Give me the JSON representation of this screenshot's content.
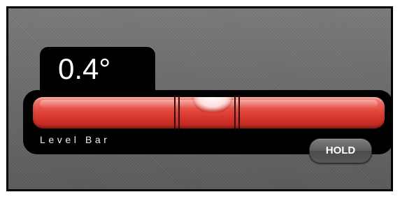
{
  "readout": {
    "value": "0.4°"
  },
  "level_bar": {
    "label": "Level Bar",
    "tube_color": "#e2463d"
  },
  "hold_button": {
    "label": "HOLD"
  }
}
